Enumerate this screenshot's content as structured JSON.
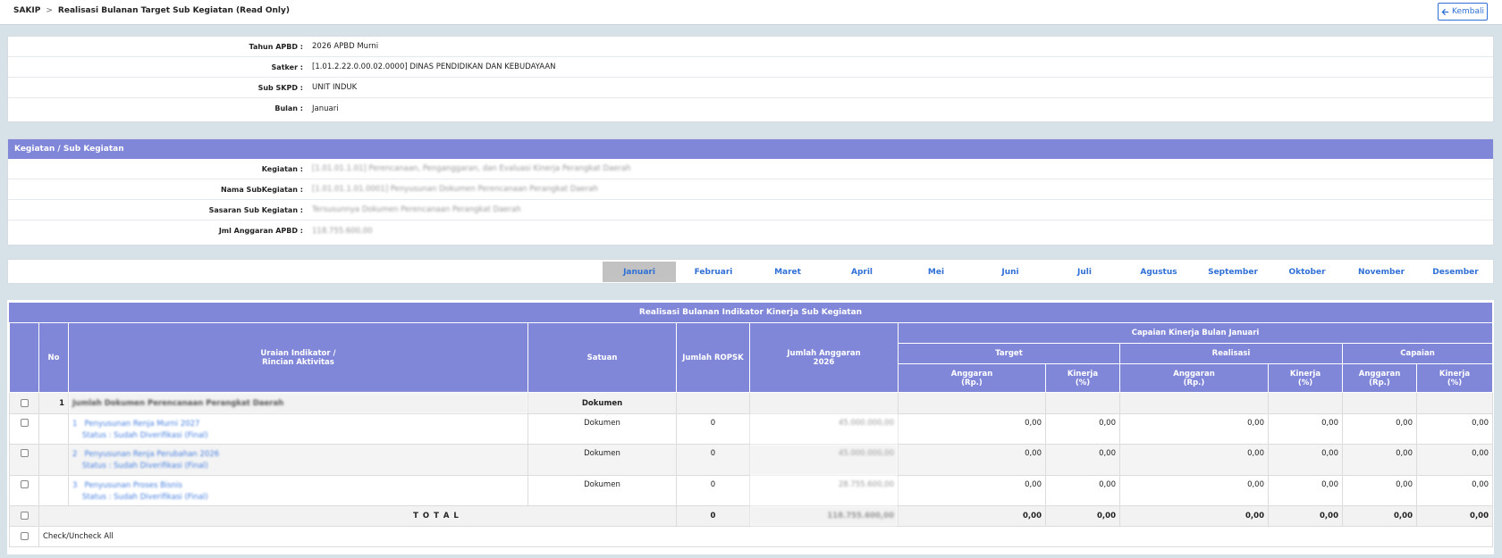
{
  "breadcrumb": {
    "root": "SAKIP",
    "separator": ">",
    "current": "Realisasi Bulanan Target Sub Kegiatan (Read Only)"
  },
  "header": {
    "back_label": "Kembali",
    "back_icon": "arrow-left-icon",
    "accent_color": "#2f6fd6"
  },
  "info": {
    "tahun_label": "Tahun APBD :",
    "tahun_value": "2026 APBD Murni",
    "satker_label": "Satker :",
    "satker_value": "[1.01.2.22.0.00.02.0000] DINAS PENDIDIKAN DAN KEBUDAYAAN",
    "subskpd_label": "Sub SKPD :",
    "subskpd_value": "UNIT INDUK",
    "bulan_label": "Bulan :",
    "bulan_value": "Januari"
  },
  "kegiatan": {
    "title": "Kegiatan / Sub Kegiatan",
    "header_color": "#8187d8",
    "kegiatan_label": "Kegiatan :",
    "kegiatan_value": "[1.01.01.1.01] Perencanaan, Penganggaran, dan Evaluasi Kinerja Perangkat Daerah",
    "subkegiatan_label": "Nama SubKegiatan :",
    "subkegiatan_value": "[1.01.01.1.01.0001] Penyusunan Dokumen Perencanaan Perangkat Daerah",
    "sasaran_label": "Sasaran Sub Kegiatan :",
    "sasaran_value": "Tersusunnya Dokumen Perencanaan Perangkat Daerah",
    "anggaran_label": "Jml Anggaran APBD :",
    "anggaran_value": "118.755.600,00"
  },
  "months": [
    "Januari",
    "Februari",
    "Maret",
    "April",
    "Mei",
    "Juni",
    "Juli",
    "Agustus",
    "September",
    "Oktober",
    "November",
    "Desember"
  ],
  "active_month": "Januari",
  "table": {
    "title": "Realisasi Bulanan Indikator Kinerja Sub Kegiatan",
    "col_no": "No",
    "col_uraian_1": "Uraian Indikator /",
    "col_uraian_2": "Rincian Aktivitas",
    "col_satuan": "Satuan",
    "col_ropsk": "Jumlah ROPSK",
    "col_anggaran_1": "Jumlah Anggaran",
    "col_anggaran_2": "2026",
    "col_capaian_group": "Capaian Kinerja Bulan Januari",
    "col_target": "Target",
    "col_realisasi": "Realisasi",
    "col_capaian": "Capaian",
    "sub_anggaran_1": "Anggaran",
    "sub_anggaran_2": "(Rp.)",
    "sub_kinerja_1": "Kinerja",
    "sub_kinerja_2": "(%)",
    "group_row": {
      "no": "1",
      "uraian": "Jumlah Dokumen Perencanaan Perangkat Daerah",
      "satuan": "Dokumen"
    },
    "rows": [
      {
        "idx": "1",
        "title": "Penyusunan Renja Murni 2027",
        "status": "Status : Sudah Diverifikasi (Final)",
        "satuan": "Dokumen",
        "ropsk": "0",
        "anggaran": "45.000.000,00",
        "t_ang": "0,00",
        "t_kin": "0,00",
        "r_ang": "0,00",
        "r_kin": "0,00",
        "c_ang": "0,00",
        "c_kin": "0,00"
      },
      {
        "idx": "2",
        "title": "Penyusunan Renja Perubahan 2026",
        "status": "Status : Sudah Diverifikasi (Final)",
        "satuan": "Dokumen",
        "ropsk": "0",
        "anggaran": "45.000.000,00",
        "t_ang": "0,00",
        "t_kin": "0,00",
        "r_ang": "0,00",
        "r_kin": "0,00",
        "c_ang": "0,00",
        "c_kin": "0,00"
      },
      {
        "idx": "3",
        "title": "Penyusunan Proses Bisnis",
        "status": "Status : Sudah Diverifikasi (Final)",
        "satuan": "Dokumen",
        "ropsk": "0",
        "anggaran": "28.755.600,00",
        "t_ang": "0,00",
        "t_kin": "0,00",
        "r_ang": "0,00",
        "r_kin": "0,00",
        "c_ang": "0,00",
        "c_kin": "0,00"
      }
    ],
    "total": {
      "label": "T O T A L",
      "ropsk": "0",
      "anggaran": "118.755.600,00",
      "t_ang": "0,00",
      "t_kin": "0,00",
      "r_ang": "0,00",
      "r_kin": "0,00",
      "c_ang": "0,00",
      "c_kin": "0,00"
    },
    "check_all_label": "Check/Uncheck All"
  }
}
